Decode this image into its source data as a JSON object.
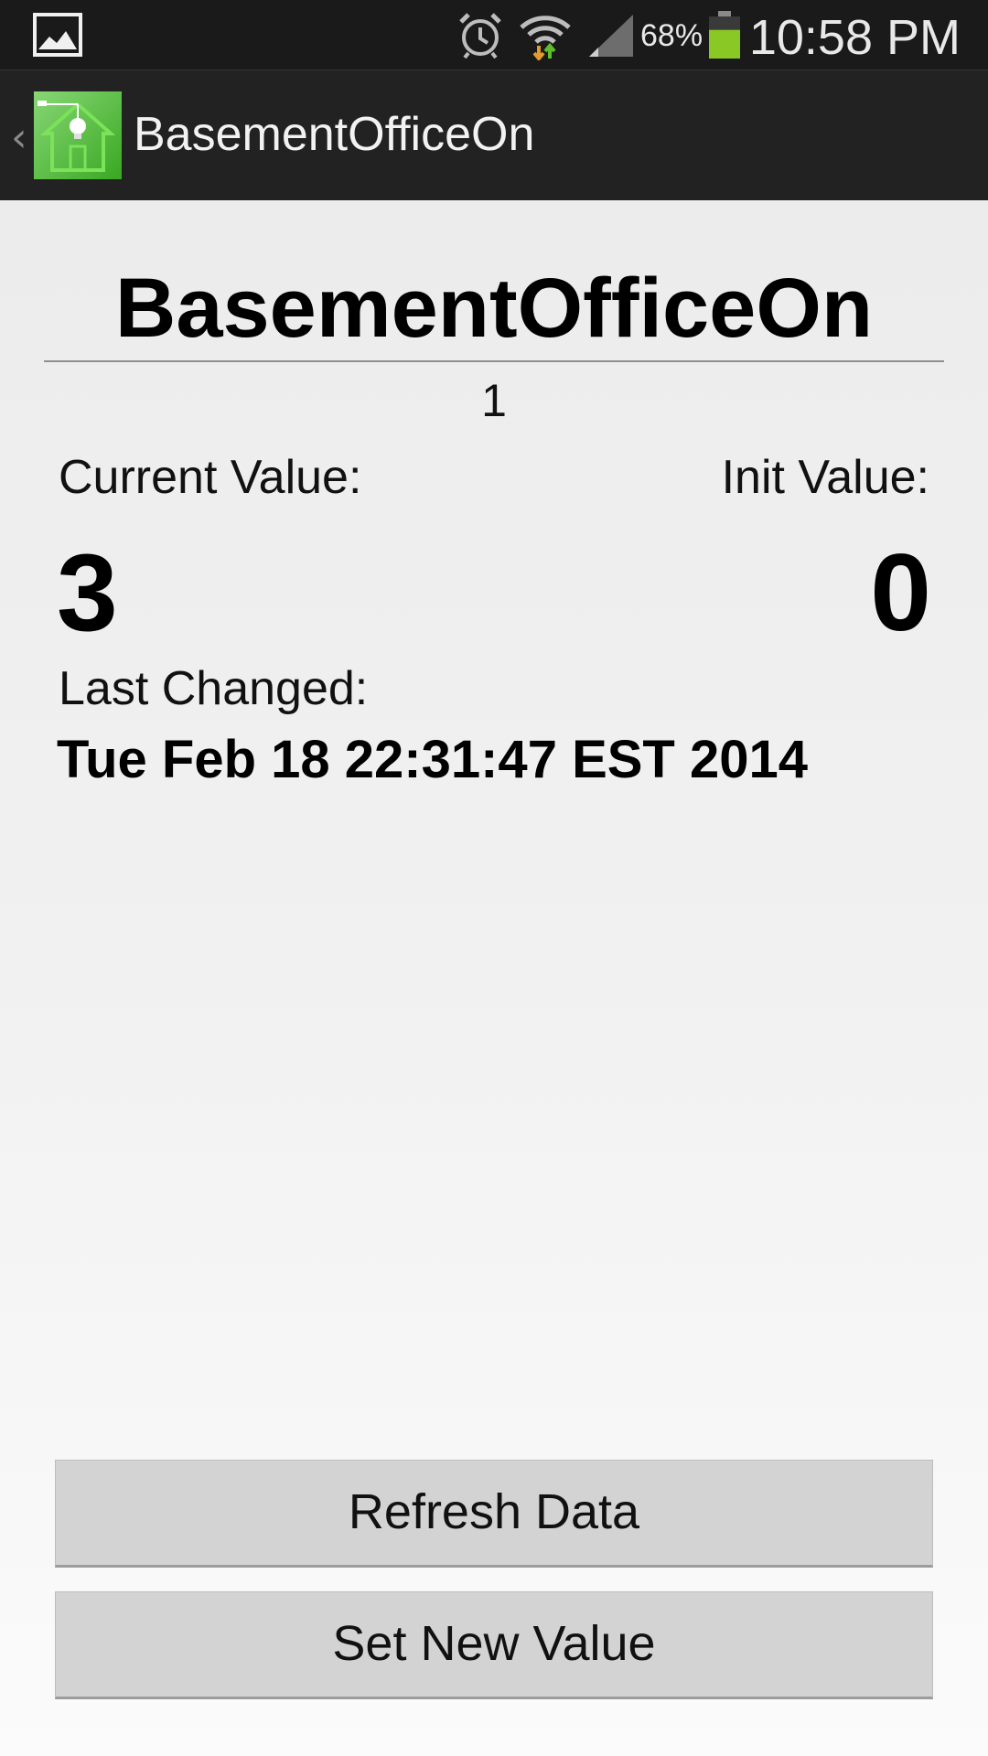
{
  "status_bar": {
    "battery_percent": "68%",
    "time": "10:58 PM",
    "icons": [
      "gallery-icon",
      "alarm-icon",
      "wifi-icon",
      "signal-icon",
      "battery-icon"
    ],
    "battery_level": 0.68
  },
  "action_bar": {
    "back_glyph": "‹",
    "title": "BasementOfficeOn",
    "icon": "house-bulb-app-icon",
    "icon_color": "#44c12a"
  },
  "main": {
    "heading": "BasementOfficeOn",
    "sub_number": "1",
    "current_label": "Current Value:",
    "current_value": "3",
    "init_label": "Init Value:",
    "init_value": "0",
    "changed_label": "Last Changed:",
    "changed_value": "Tue Feb 18 22:31:47 EST 2014"
  },
  "buttons": {
    "refresh": "Refresh Data",
    "set_value": "Set New Value"
  }
}
